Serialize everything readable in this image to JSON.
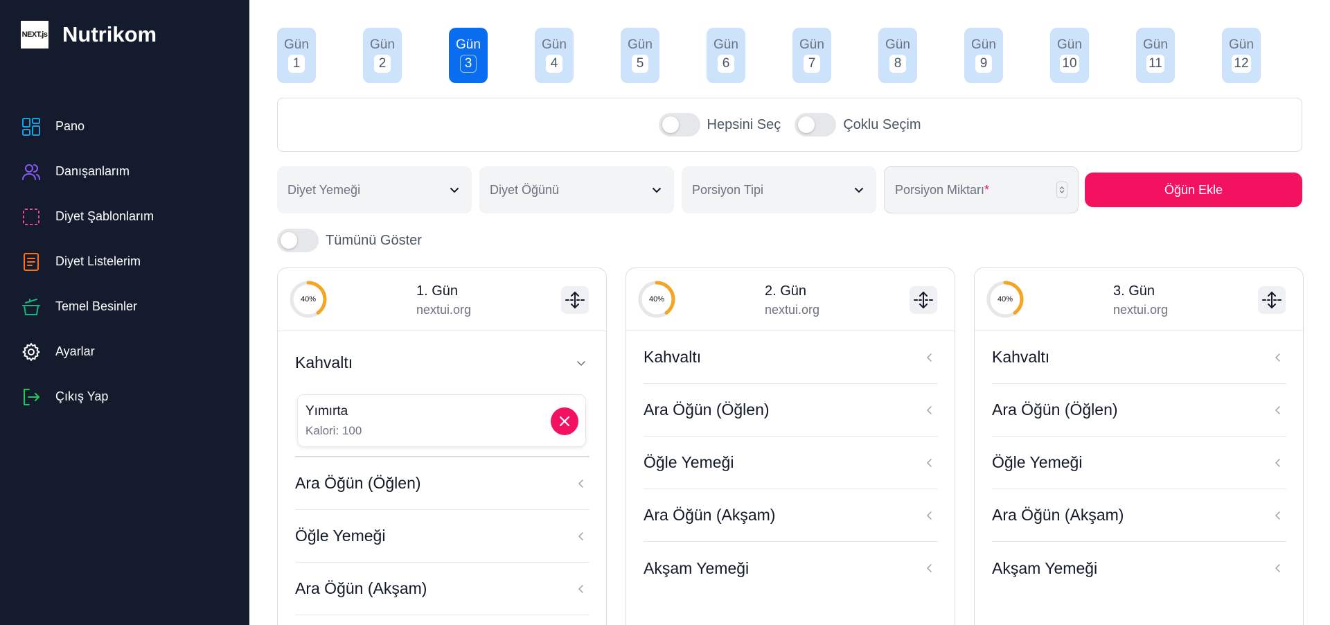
{
  "brand": {
    "logo_text": "NEXT.js",
    "name": "Nutrikom"
  },
  "sidebar": {
    "items": [
      {
        "label": "Pano",
        "icon": "dashboard-icon",
        "color": "#1a9fe0"
      },
      {
        "label": "Danışanlarım",
        "icon": "users-icon",
        "color": "#8b5cf6"
      },
      {
        "label": "Diyet Şablonlarım",
        "icon": "template-icon",
        "color": "#ec4899"
      },
      {
        "label": "Diyet Listelerim",
        "icon": "list-icon",
        "color": "#f97316"
      },
      {
        "label": "Temel Besinler",
        "icon": "pot-icon",
        "color": "#10b981"
      },
      {
        "label": "Ayarlar",
        "icon": "gear-icon",
        "color": "#ffffff"
      },
      {
        "label": "Çıkış Yap",
        "icon": "logout-icon",
        "color": "#22c55e"
      }
    ]
  },
  "days": {
    "label": "Gün",
    "active": 3,
    "items": [
      "1",
      "2",
      "3",
      "4",
      "5",
      "6",
      "7",
      "8",
      "9",
      "10",
      "11",
      "12"
    ]
  },
  "toggles": {
    "select_all": {
      "label": "Hepsini Seç",
      "on": false
    },
    "multi_select": {
      "label": "Çoklu Seçim",
      "on": false
    }
  },
  "form": {
    "diet_food_placeholder": "Diyet Yemeği",
    "diet_meal_placeholder": "Diyet Öğünü",
    "portion_type_placeholder": "Porsiyon Tipi",
    "portion_amount_placeholder": "Porsiyon Miktarı",
    "required_mark": "*",
    "add_button": "Öğün Ekle"
  },
  "show_all": {
    "label": "Tümünü Göster",
    "on": false
  },
  "colors": {
    "sidebar_bg": "#141b2d",
    "accent_blue": "#0a6df0",
    "accent_pink": "#f31260",
    "day_bg": "#cde2fb",
    "progress": "#f5a524"
  },
  "cards": [
    {
      "title": "1. Gün",
      "subtitle": "nextui.org",
      "progress": 0.4,
      "progress_label": "40%",
      "meals": [
        {
          "label": "Kahvaltı",
          "open": true,
          "foods": [
            {
              "name": "Yımırta",
              "calories": "Kalori: 100"
            }
          ]
        },
        {
          "label": "Ara Öğün (Öğlen)",
          "open": false
        },
        {
          "label": "Öğle Yemeği",
          "open": false
        },
        {
          "label": "Ara Öğün (Akşam)",
          "open": false
        }
      ]
    },
    {
      "title": "2. Gün",
      "subtitle": "nextui.org",
      "progress": 0.4,
      "progress_label": "40%",
      "meals": [
        {
          "label": "Kahvaltı",
          "open": false
        },
        {
          "label": "Ara Öğün (Öğlen)",
          "open": false
        },
        {
          "label": "Öğle Yemeği",
          "open": false
        },
        {
          "label": "Ara Öğün (Akşam)",
          "open": false
        },
        {
          "label": "Akşam Yemeği",
          "open": false
        }
      ]
    },
    {
      "title": "3. Gün",
      "subtitle": "nextui.org",
      "progress": 0.4,
      "progress_label": "40%",
      "meals": [
        {
          "label": "Kahvaltı",
          "open": false
        },
        {
          "label": "Ara Öğün (Öğlen)",
          "open": false
        },
        {
          "label": "Öğle Yemeği",
          "open": false
        },
        {
          "label": "Ara Öğün (Akşam)",
          "open": false
        },
        {
          "label": "Akşam Yemeği",
          "open": false
        }
      ]
    }
  ]
}
